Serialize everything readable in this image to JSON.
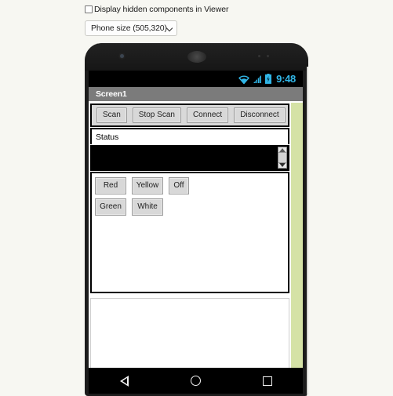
{
  "designer": {
    "hidden_components_checkbox_label": "Display hidden components in Viewer",
    "phone_size_value": "Phone size (505,320)",
    "chevron_icon": "chevron-down-icon"
  },
  "phone": {
    "front_camera_icon": "front-camera-icon",
    "earpiece_icon": "earpiece-speaker-icon",
    "sensor_icon": "sensor-dots-icon",
    "status_bar": {
      "wifi_icon": "wifi-icon",
      "signal_icon": "cellular-signal-icon",
      "battery_icon": "battery-icon",
      "clock": "9:48",
      "icon_color": "#31b6e7"
    },
    "title_bar": {
      "title": "Screen1",
      "background": "#7b7b7b"
    },
    "nav_bar": {
      "back_icon": "nav-back-icon",
      "home_icon": "nav-home-icon",
      "recent_icon": "nav-recent-icon"
    }
  },
  "app": {
    "action_buttons": [
      {
        "label": "Scan"
      },
      {
        "label": "Stop Scan"
      },
      {
        "label": "Connect"
      },
      {
        "label": "Disconnect"
      }
    ],
    "status_label": "Status",
    "listview": {
      "background": "#000000",
      "items": [],
      "scroll_up_icon": "scroll-arrow-up-icon",
      "scroll_down_icon": "scroll-arrow-down-icon"
    },
    "color_buttons": [
      [
        {
          "label": "Red",
          "narrow": false
        },
        {
          "label": "Yellow",
          "narrow": false
        },
        {
          "label": "Off",
          "narrow": true
        }
      ],
      [
        {
          "label": "Green",
          "narrow": false
        },
        {
          "label": "White",
          "narrow": false
        }
      ]
    ],
    "accent_strip_color": "#d5e2a6"
  }
}
